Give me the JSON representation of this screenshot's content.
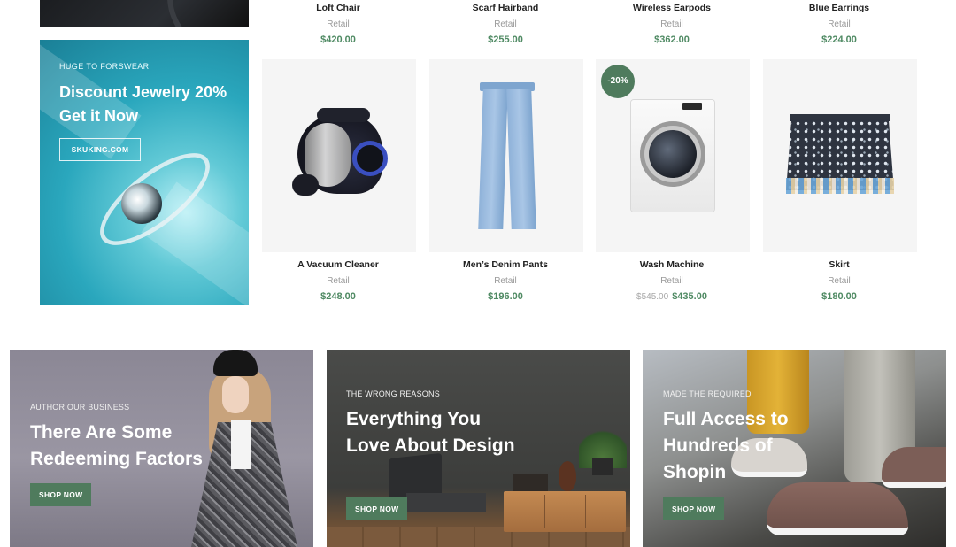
{
  "promo": {
    "kicker": "HUGE TO FORSWEAR",
    "title": "Discount Jewelry 20% Get it Now",
    "button": "SKUKING.COM"
  },
  "products_top": [
    {
      "name": "Loft Chair",
      "category": "Retail",
      "price": "$420.00"
    },
    {
      "name": "Scarf Hairband",
      "category": "Retail",
      "price": "$255.00"
    },
    {
      "name": "Wireless Earpods",
      "category": "Retail",
      "price": "$362.00"
    },
    {
      "name": "Blue Earrings",
      "category": "Retail",
      "price": "$224.00"
    }
  ],
  "products": [
    {
      "name": "A Vacuum Cleaner",
      "category": "Retail",
      "price": "$248.00",
      "image": "vacuum-cleaner"
    },
    {
      "name": "Men’s Denim Pants",
      "category": "Retail",
      "price": "$196.00",
      "image": "denim-pants"
    },
    {
      "name": "Wash Machine",
      "category": "Retail",
      "old_price": "$545.00",
      "price": "$435.00",
      "badge": "-20%",
      "image": "washing-machine"
    },
    {
      "name": "Skirt",
      "category": "Retail",
      "price": "$180.00",
      "image": "skirt"
    }
  ],
  "banners": [
    {
      "kicker": "AUTHOR OUR BUSINESS",
      "title": "There Are Some Redeeming Factors",
      "button": "SHOP NOW"
    },
    {
      "kicker": "THE WRONG REASONS",
      "title": "Everything You Love About Design",
      "button": "SHOP NOW"
    },
    {
      "kicker": "MADE THE REQUIRED",
      "title": "Full Access to Hundreds of Shopin",
      "button": "SHOP NOW"
    }
  ],
  "colors": {
    "accent_green": "#4f7b5d",
    "price_green": "#4f8a63",
    "muted_text": "#9a9a9a"
  }
}
